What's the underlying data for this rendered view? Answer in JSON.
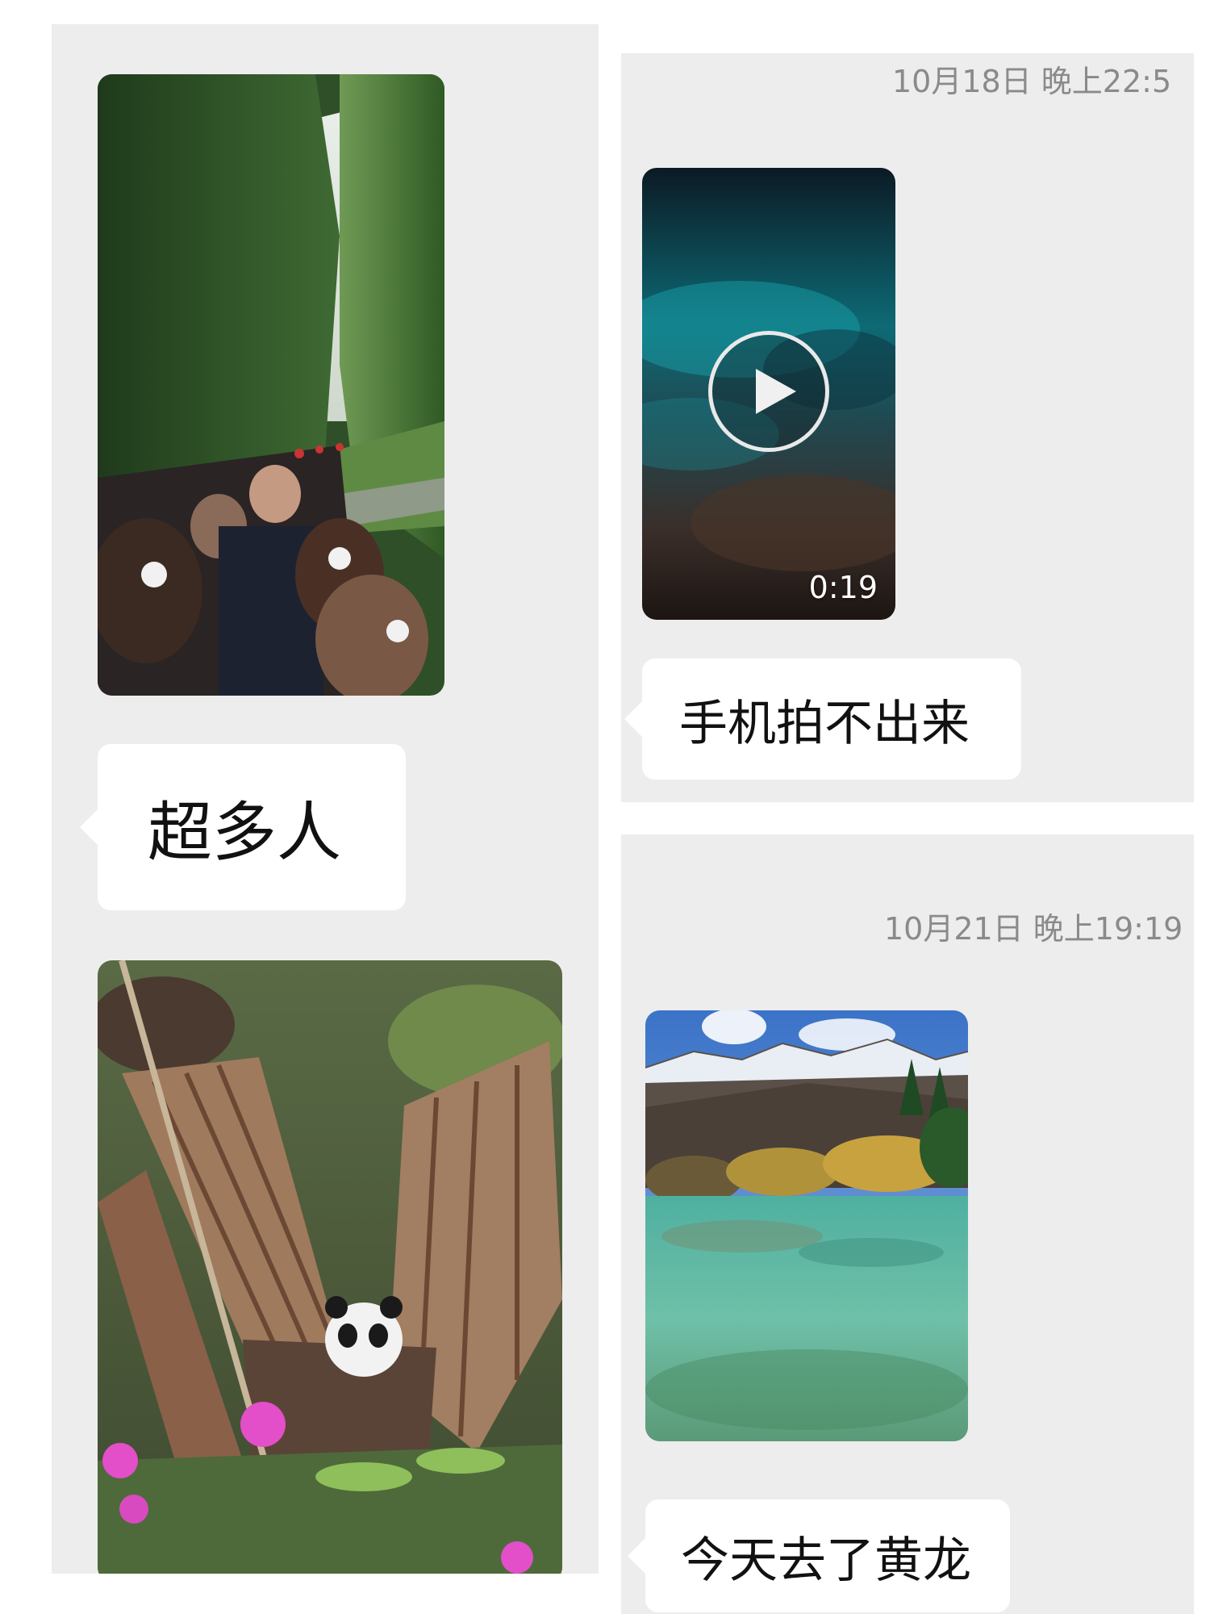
{
  "left_panel": {
    "images": [
      {
        "name": "crowd-photo",
        "subject": "crowded bamboo path"
      },
      {
        "name": "panda-photo",
        "subject": "panda in bamboo tree"
      }
    ],
    "message": "超多人"
  },
  "right_top_panel": {
    "timestamp": "10月18日 晚上22:5",
    "video": {
      "duration": "0:19",
      "icon": "play-icon"
    },
    "message": "手机拍不出来"
  },
  "right_bottom_panel": {
    "timestamp": "10月21日 晚上19:19",
    "image": {
      "name": "lake-photo",
      "subject": "mountain lake"
    },
    "message": "今天去了黄龙"
  },
  "colors": {
    "panel_background": "#ededed",
    "bubble_background": "#ffffff",
    "timestamp_text": "#8a8a8a",
    "message_text": "#111111"
  }
}
